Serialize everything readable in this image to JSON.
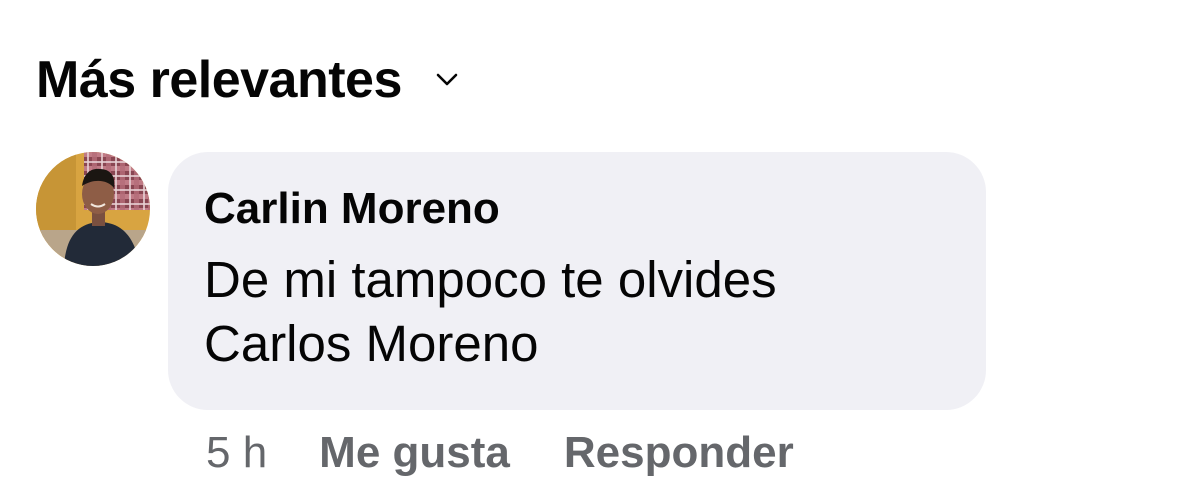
{
  "header": {
    "sort_label": "Más relevantes",
    "sort_icon": "chevron-down-icon"
  },
  "comment": {
    "author": "Carlin Moreno",
    "text_line1": "De mi tampoco te olvides",
    "text_line2": "Carlos Moreno",
    "timestamp": "5 h",
    "like_label": "Me gusta",
    "reply_label": "Responder"
  },
  "colors": {
    "bubble_bg": "#f0f0f5",
    "primary_text": "#050505",
    "secondary_text": "#65676b"
  }
}
